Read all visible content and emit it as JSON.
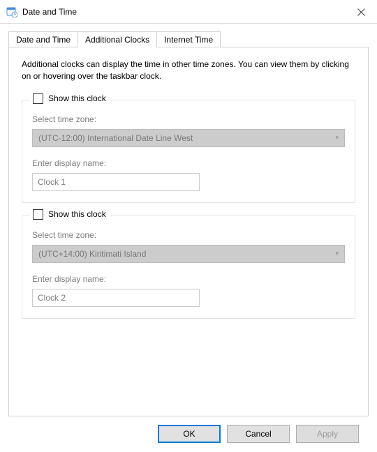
{
  "window": {
    "title": "Date and Time"
  },
  "tabs": {
    "t0": "Date and Time",
    "t1": "Additional Clocks",
    "t2": "Internet Time"
  },
  "description": "Additional clocks can display the time in other time zones. You can view them by clicking on or hovering over the taskbar clock.",
  "clock1": {
    "show_label": "Show this clock",
    "tz_label": "Select time zone:",
    "tz_value": "(UTC-12:00) International Date Line West",
    "name_label": "Enter display name:",
    "name_value": "Clock 1"
  },
  "clock2": {
    "show_label": "Show this clock",
    "tz_label": "Select time zone:",
    "tz_value": "(UTC+14:00) Kiritimati Island",
    "name_label": "Enter display name:",
    "name_value": "Clock 2"
  },
  "buttons": {
    "ok": "OK",
    "cancel": "Cancel",
    "apply": "Apply"
  }
}
